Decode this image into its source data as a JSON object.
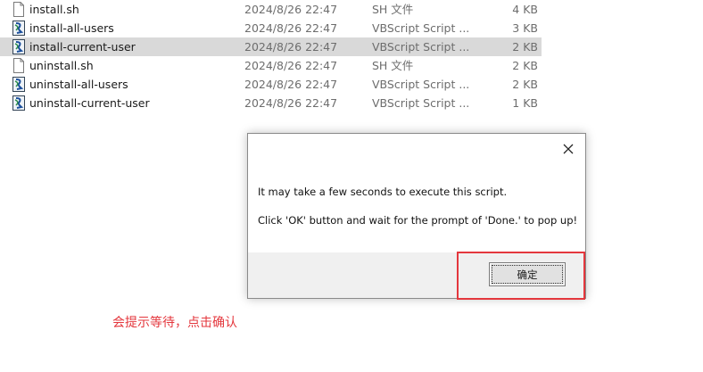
{
  "files": [
    {
      "name": "install.sh",
      "date": "2024/8/26 22:47",
      "type": "SH 文件",
      "size": "4 KB",
      "icon": "document-icon"
    },
    {
      "name": "install-all-users",
      "date": "2024/8/26 22:47",
      "type": "VBScript Script ...",
      "size": "3 KB",
      "icon": "vbscript-icon"
    },
    {
      "name": "install-current-user",
      "date": "2024/8/26 22:47",
      "type": "VBScript Script ...",
      "size": "2 KB",
      "icon": "vbscript-icon",
      "selected": true
    },
    {
      "name": "uninstall.sh",
      "date": "2024/8/26 22:47",
      "type": "SH 文件",
      "size": "2 KB",
      "icon": "document-icon"
    },
    {
      "name": "uninstall-all-users",
      "date": "2024/8/26 22:47",
      "type": "VBScript Script ...",
      "size": "2 KB",
      "icon": "vbscript-icon"
    },
    {
      "name": "uninstall-current-user",
      "date": "2024/8/26 22:47",
      "type": "VBScript Script ...",
      "size": "1 KB",
      "icon": "vbscript-icon"
    }
  ],
  "dialog": {
    "message_line1": "It may take a few seconds to execute this script.",
    "message_line2": "Click 'OK' button and wait for the prompt of 'Done.' to pop up!",
    "ok_label": "确定",
    "close_icon": "close-icon"
  },
  "annotation": {
    "text": "会提示等待，点击确认",
    "color": "#e4373d"
  },
  "colors": {
    "selected_row": "#d9d9d9",
    "dialog_footer": "#f0f0f0",
    "highlight": "#e4373d"
  }
}
